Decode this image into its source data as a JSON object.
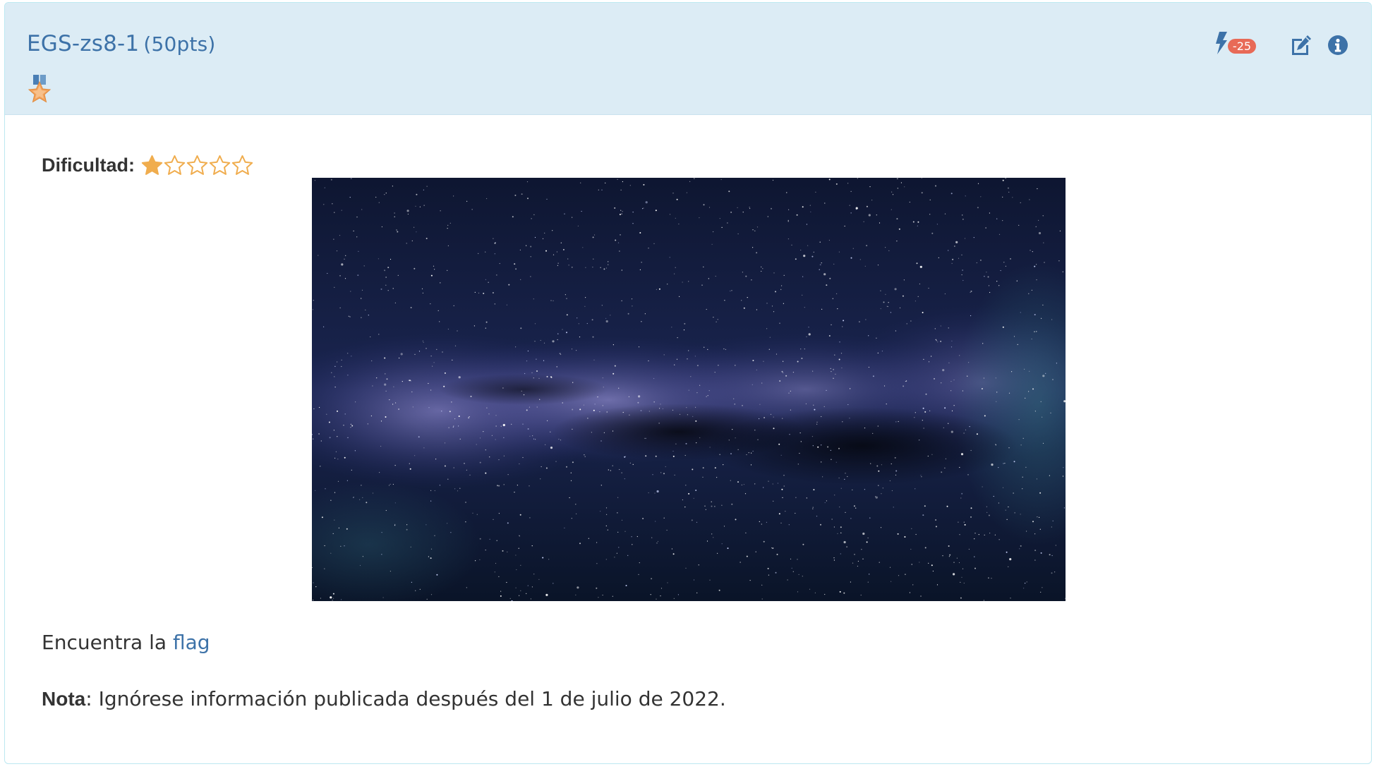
{
  "challenge": {
    "name": "EGS-zs8-1",
    "points": "(50pts)",
    "medal_icon": "medal-star-icon"
  },
  "actions": {
    "boost_icon": "bolt-icon",
    "boost_badge": "-25",
    "edit_icon": "edit-icon",
    "info_icon": "info-icon"
  },
  "difficulty": {
    "label": "Dificultad:",
    "rating": 1,
    "max": 5
  },
  "image": {
    "description": "Milky Way starfield"
  },
  "body": {
    "text_before_link": "Encuentra la ",
    "link_text": "flag",
    "note_label": "Nota",
    "note_text": ": Ignórese información publicada después del 1 de julio de 2022."
  },
  "colors": {
    "heading_bg": "#dcecf5",
    "link": "#3d72a8",
    "badge": "#e86a57",
    "star": "#f0ad4e"
  }
}
